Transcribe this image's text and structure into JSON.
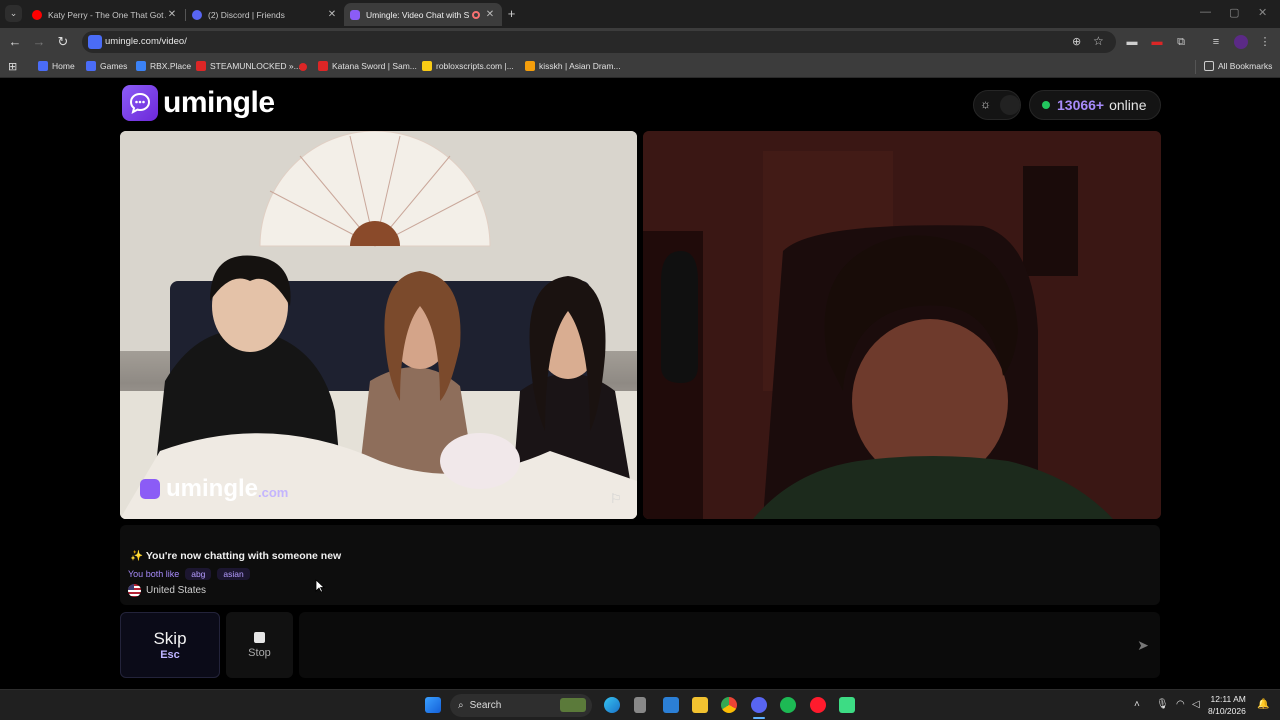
{
  "browser": {
    "tabs": [
      {
        "title": "Katy Perry - The One That Got A",
        "favicon_color": "#ff0000"
      },
      {
        "title": "(2) Discord | Friends",
        "favicon_color": "#5865f2"
      },
      {
        "title": "Umingle: Video Chat with S",
        "favicon_color": "#8b5cf6"
      }
    ],
    "url": "umingle.com/video/",
    "bookmarks": [
      {
        "label": "Home",
        "color": "#4a6cf7"
      },
      {
        "label": "Games",
        "color": "#4a6cf7"
      },
      {
        "label": "RBX.Place",
        "color": "#3b82f6"
      },
      {
        "label": "STEAMUNLOCKED »...",
        "color": "#dc2626"
      },
      {
        "label": "Katana Sword | Sam...",
        "color": "#dc2626"
      },
      {
        "label": "robloxscripts.com |...",
        "color": "#facc15"
      },
      {
        "label": "kisskh | Asian Dram...",
        "color": "#f59e0b"
      }
    ],
    "all_bookmarks": "All Bookmarks"
  },
  "site": {
    "logo_text": "umingle",
    "online_count": "13066+",
    "online_label": "online",
    "watermark_main": "umingle",
    "watermark_suffix": ".com",
    "accent": "#8b5cf6"
  },
  "chat": {
    "status_icon": "✨",
    "status_text": "You're now chatting with someone new",
    "common_label": "You both like",
    "interests": [
      "abg",
      "asian"
    ],
    "country": "United States",
    "input_placeholder": ""
  },
  "controls": {
    "skip_label": "Skip",
    "skip_shortcut": "Esc",
    "stop_label": "Stop"
  },
  "taskbar": {
    "search_placeholder": "Search",
    "time": "12:11 AM",
    "date": "8/10/2026"
  }
}
